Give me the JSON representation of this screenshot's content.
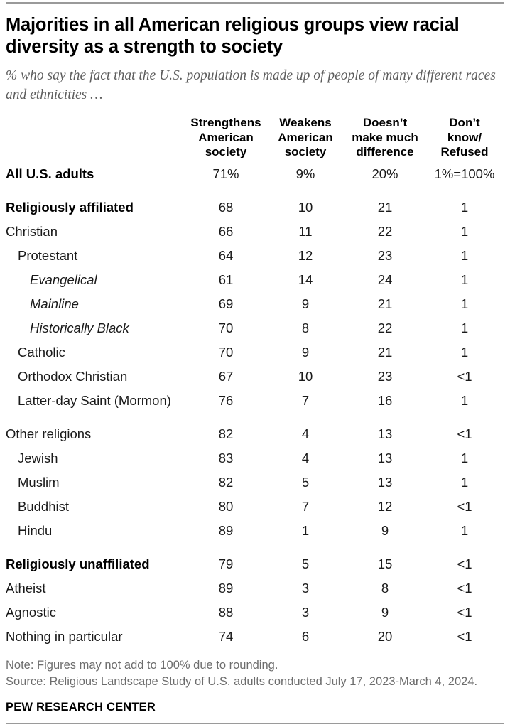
{
  "title": "Majorities in all American religious groups view racial diversity as a strength to society",
  "subtitle": "% who say the fact that the U.S. population is made up of people of many different races and ethnicities …",
  "note": "Note: Figures may not add to 100% due to rounding.",
  "source": "Source: Religious Landscape Study of U.S. adults conducted July 17, 2023-March 4, 2024.",
  "brand": "PEW RESEARCH CENTER",
  "chart_data": {
    "type": "table",
    "title": "Majorities in all American religious groups view racial diversity as a strength to society",
    "subtitle": "% who say the fact that the U.S. population is made up of people of many different races and ethnicities …",
    "row_header_label": "",
    "categories": [
      "All U.S. adults",
      "Religiously affiliated",
      "Christian",
      "Protestant",
      "Evangelical",
      "Mainline",
      "Historically Black",
      "Catholic",
      "Orthodox Christian",
      "Latter-day Saint (Mormon)",
      "Other religions",
      "Jewish",
      "Muslim",
      "Buddhist",
      "Hindu",
      "Religiously unaffiliated",
      "Atheist",
      "Agnostic",
      "Nothing in particular"
    ],
    "columns": [
      "Strengthens American society",
      "Weakens American society",
      "Doesn't make much difference",
      "Don't know/ Refused"
    ],
    "series": [
      {
        "name": "Strengthens American society",
        "values": [
          71,
          68,
          66,
          64,
          61,
          69,
          70,
          70,
          67,
          76,
          82,
          83,
          82,
          80,
          89,
          79,
          89,
          88,
          74
        ]
      },
      {
        "name": "Weakens American society",
        "values": [
          9,
          10,
          11,
          12,
          14,
          9,
          8,
          9,
          10,
          7,
          4,
          4,
          5,
          7,
          1,
          5,
          3,
          3,
          6
        ]
      },
      {
        "name": "Doesn't make much difference",
        "values": [
          20,
          21,
          22,
          23,
          24,
          21,
          22,
          21,
          23,
          16,
          13,
          13,
          13,
          12,
          9,
          15,
          8,
          9,
          20
        ]
      },
      {
        "name": "Don't know/ Refused",
        "values": [
          1,
          1,
          1,
          1,
          1,
          1,
          1,
          1,
          0.5,
          1,
          0.5,
          1,
          1,
          0.5,
          1,
          0.5,
          0.5,
          0.5,
          0.5
        ]
      }
    ],
    "note": "Note: Figures may not add to 100% due to rounding.",
    "source": "Source: Religious Landscape Study of U.S. adults conducted July 17, 2023-March 4, 2024."
  },
  "header": {
    "label_col": "",
    "col1_lines": [
      "Strengthens",
      "American",
      "society"
    ],
    "col2_lines": [
      "Weakens",
      "American",
      "society"
    ],
    "col3_lines": [
      "Doesn’t",
      "make much",
      "difference"
    ],
    "col4_lines": [
      "Don’t",
      "know/",
      "Refused"
    ]
  },
  "rows": [
    {
      "label": "All U.S. adults",
      "indent": 0,
      "style": "total",
      "gap": false,
      "v1": "71%",
      "v2": "9%",
      "v3": "20%",
      "v4": "1%=100%"
    },
    {
      "label": "Religiously affiliated",
      "indent": 0,
      "style": "bold",
      "gap": true,
      "v1": "68",
      "v2": "10",
      "v3": "21",
      "v4": "1"
    },
    {
      "label": "Christian",
      "indent": 0,
      "style": "normal",
      "gap": false,
      "v1": "66",
      "v2": "11",
      "v3": "22",
      "v4": "1"
    },
    {
      "label": "Protestant",
      "indent": 1,
      "style": "normal",
      "gap": false,
      "v1": "64",
      "v2": "12",
      "v3": "23",
      "v4": "1"
    },
    {
      "label": "Evangelical",
      "indent": 2,
      "style": "italic",
      "gap": false,
      "v1": "61",
      "v2": "14",
      "v3": "24",
      "v4": "1"
    },
    {
      "label": "Mainline",
      "indent": 2,
      "style": "italic",
      "gap": false,
      "v1": "69",
      "v2": "9",
      "v3": "21",
      "v4": "1"
    },
    {
      "label": "Historically Black",
      "indent": 2,
      "style": "italic",
      "gap": false,
      "v1": "70",
      "v2": "8",
      "v3": "22",
      "v4": "1"
    },
    {
      "label": "Catholic",
      "indent": 1,
      "style": "normal",
      "gap": false,
      "v1": "70",
      "v2": "9",
      "v3": "21",
      "v4": "1"
    },
    {
      "label": "Orthodox Christian",
      "indent": 1,
      "style": "normal",
      "gap": false,
      "v1": "67",
      "v2": "10",
      "v3": "23",
      "v4": "<1"
    },
    {
      "label": "Latter-day Saint (Mormon)",
      "indent": 1,
      "style": "normal",
      "gap": false,
      "v1": "76",
      "v2": "7",
      "v3": "16",
      "v4": "1"
    },
    {
      "label": "Other religions",
      "indent": 0,
      "style": "normal",
      "gap": true,
      "v1": "82",
      "v2": "4",
      "v3": "13",
      "v4": "<1"
    },
    {
      "label": "Jewish",
      "indent": 1,
      "style": "normal",
      "gap": false,
      "v1": "83",
      "v2": "4",
      "v3": "13",
      "v4": "1"
    },
    {
      "label": "Muslim",
      "indent": 1,
      "style": "normal",
      "gap": false,
      "v1": "82",
      "v2": "5",
      "v3": "13",
      "v4": "1"
    },
    {
      "label": "Buddhist",
      "indent": 1,
      "style": "normal",
      "gap": false,
      "v1": "80",
      "v2": "7",
      "v3": "12",
      "v4": "<1"
    },
    {
      "label": "Hindu",
      "indent": 1,
      "style": "normal",
      "gap": false,
      "v1": "89",
      "v2": "1",
      "v3": "9",
      "v4": "1"
    },
    {
      "label": "Religiously unaffiliated",
      "indent": 0,
      "style": "bold",
      "gap": true,
      "v1": "79",
      "v2": "5",
      "v3": "15",
      "v4": "<1"
    },
    {
      "label": "Atheist",
      "indent": 0,
      "style": "normal",
      "gap": false,
      "v1": "89",
      "v2": "3",
      "v3": "8",
      "v4": "<1"
    },
    {
      "label": "Agnostic",
      "indent": 0,
      "style": "normal",
      "gap": false,
      "v1": "88",
      "v2": "3",
      "v3": "9",
      "v4": "<1"
    },
    {
      "label": "Nothing in particular",
      "indent": 0,
      "style": "normal",
      "gap": false,
      "v1": "74",
      "v2": "6",
      "v3": "20",
      "v4": "<1"
    }
  ]
}
